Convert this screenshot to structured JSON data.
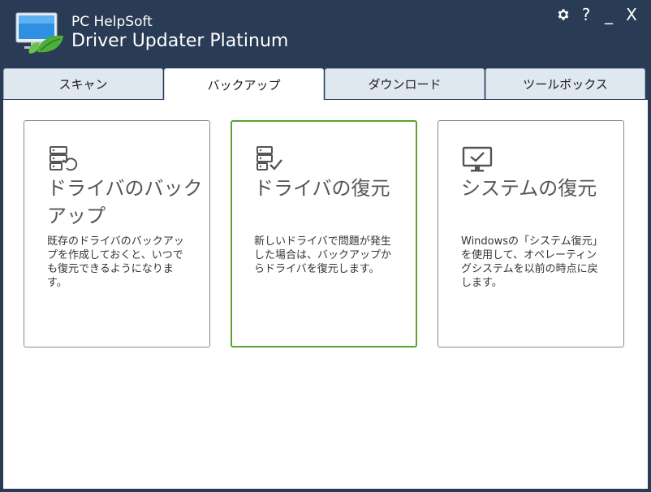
{
  "header": {
    "company": "PC HelpSoft",
    "product": "Driver Updater Platinum",
    "controls": {
      "settings_icon": "gear-icon",
      "help_label": "?",
      "minimize_label": "_",
      "close_label": "X"
    }
  },
  "tabs": [
    {
      "label": "スキャン",
      "active": false
    },
    {
      "label": "バックアップ",
      "active": true
    },
    {
      "label": "ダウンロード",
      "active": false
    },
    {
      "label": "ツールボックス",
      "active": false
    }
  ],
  "cards": [
    {
      "icon": "server-restore-icon",
      "title": "ドライバのバックアップ",
      "desc": "既存のドライバのバックアップを作成しておくと、いつでも復元できるようになります。",
      "selected": false
    },
    {
      "icon": "server-check-icon",
      "title": "ドライバの復元",
      "desc": "新しいドライバで問題が発生した場合は、バックアップからドライバを復元します。",
      "selected": true
    },
    {
      "icon": "monitor-check-icon",
      "title": "システムの復元",
      "desc": "Windowsの「システム復元」を使用して、オペレーティングシステムを以前の時点に戻します。",
      "selected": false
    }
  ],
  "colors": {
    "header_bg": "#2a3b55",
    "selected_border": "#5ca134",
    "logo_green": "#4caf3a",
    "logo_blue": "#2f8fe0"
  }
}
